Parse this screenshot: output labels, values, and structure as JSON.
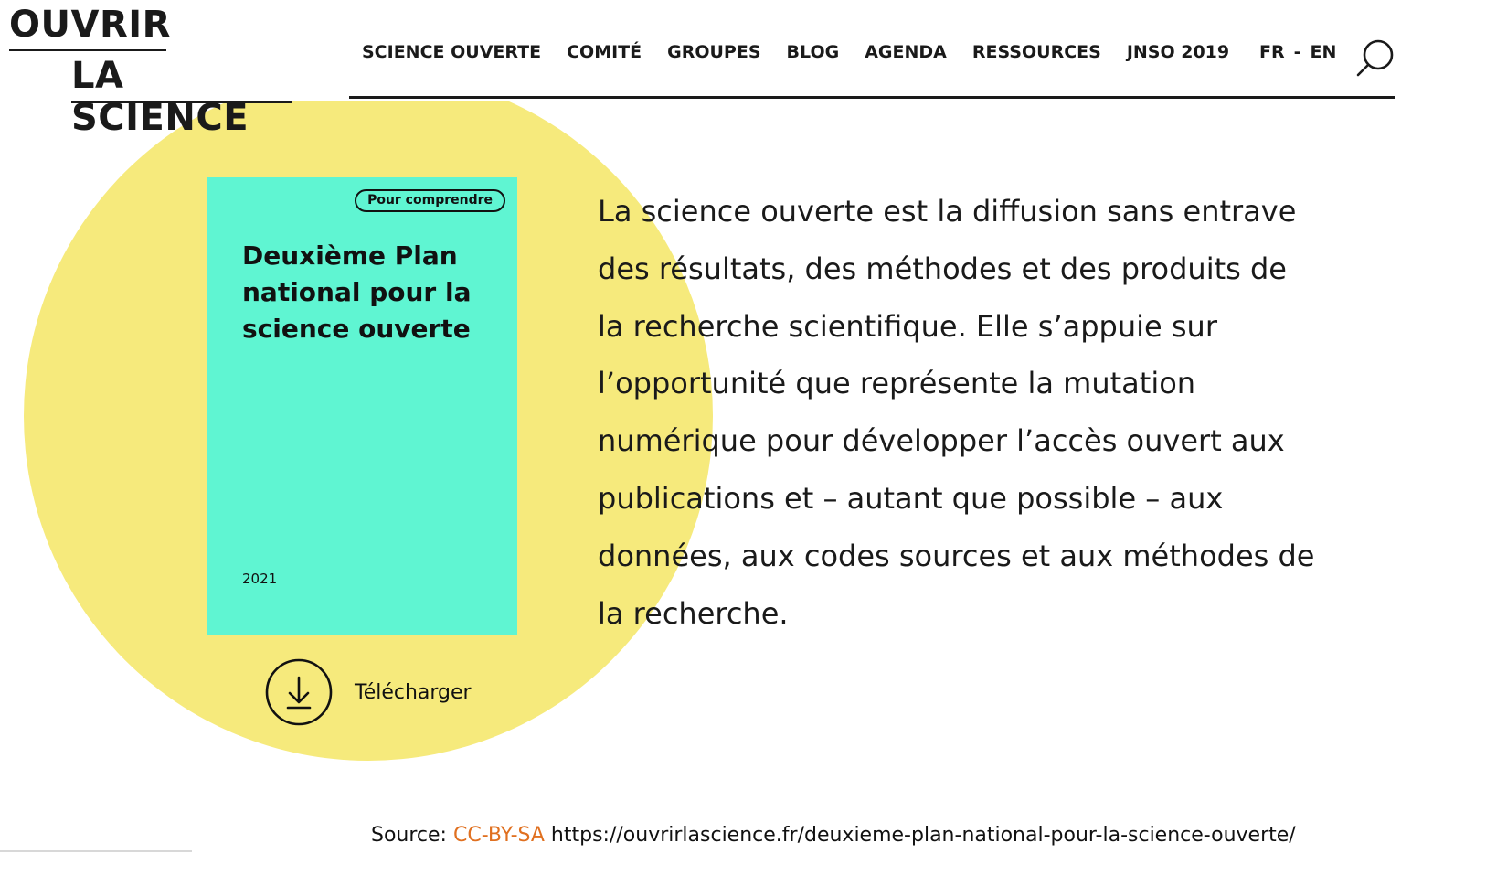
{
  "header": {
    "logo": {
      "line1": "OUVRIR",
      "line2": "LA SCIENCE"
    },
    "nav": [
      {
        "label": "SCIENCE OUVERTE"
      },
      {
        "label": "COMITÉ"
      },
      {
        "label": "GROUPES"
      },
      {
        "label": "BLOG"
      },
      {
        "label": "AGENDA"
      },
      {
        "label": "RESSOURCES"
      },
      {
        "label": "JNSO 2019"
      }
    ],
    "lang": {
      "fr": "FR",
      "separator": "-",
      "en": "EN"
    },
    "search_icon": "search-icon"
  },
  "cover": {
    "badge": "Pour comprendre",
    "title": "Deuxième Plan national pour la science ouverte",
    "year": "2021",
    "background_color": "#5ff5d2"
  },
  "download": {
    "label": "Télécharger",
    "icon": "download-icon"
  },
  "circle_color": "#f6ea7c",
  "body_text_lines": [
    "La science ouverte est la diffusion sans entrave",
    "des résultats, des méthodes et des produits de",
    "la recherche scientifique. Elle s’appuie sur",
    "l’opportunité que représente la mutation",
    "numérique pour développer l’accès ouvert aux",
    "publications et – autant que possible – aux",
    "données, aux codes sources et aux méthodes de",
    "la recherche."
  ],
  "source": {
    "prefix": "Source: ",
    "license": "CC-BY-SA",
    "url": " https://ouvrirlascience.fr/deuxieme-plan-national-pour-la-science-ouverte/",
    "license_color": "#e07020"
  }
}
